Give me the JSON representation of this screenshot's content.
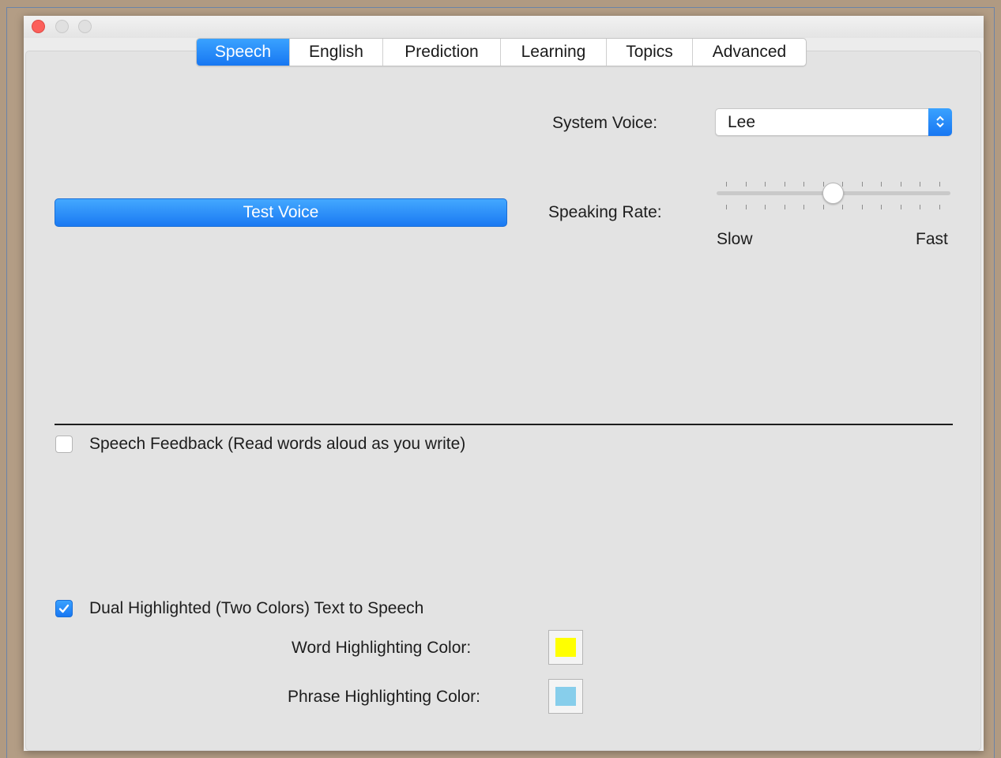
{
  "window": {
    "controls": {
      "close_icon": "close-icon",
      "minimize_icon": "minimize-icon",
      "zoom_icon": "zoom-icon"
    }
  },
  "tabs": [
    {
      "label": "Speech",
      "active": true
    },
    {
      "label": "English",
      "active": false
    },
    {
      "label": "Prediction",
      "active": false
    },
    {
      "label": "Learning",
      "active": false
    },
    {
      "label": "Topics",
      "active": false
    },
    {
      "label": "Advanced",
      "active": false
    }
  ],
  "speech": {
    "system_voice_label": "System Voice:",
    "system_voice_value": "Lee",
    "test_voice_label": "Test Voice",
    "speaking_rate_label": "Speaking Rate:",
    "rate_slow_label": "Slow",
    "rate_fast_label": "Fast",
    "speaking_rate_value": 0.5,
    "speaking_rate_tick_count": 12
  },
  "feedback": {
    "speech_feedback_label": "Speech Feedback (Read words aloud as you write)",
    "speech_feedback_checked": false
  },
  "highlight": {
    "dual_label": "Dual Highlighted (Two Colors) Text to Speech",
    "dual_checked": true,
    "word_color_label": "Word Highlighting Color:",
    "word_color": "#ffff00",
    "phrase_color_label": "Phrase Highlighting Color:",
    "phrase_color": "#87ceeb"
  },
  "colors": {
    "accent": "#1a7cf4"
  }
}
